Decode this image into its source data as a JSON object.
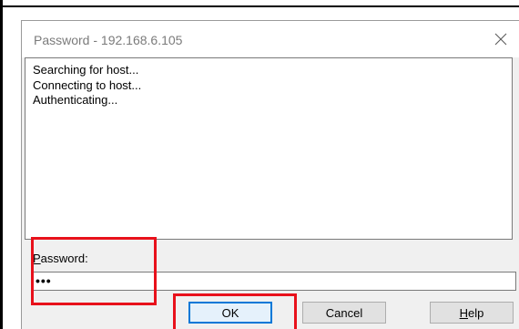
{
  "dialog": {
    "title": "Password - 192.168.6.105",
    "close_icon": "close-icon",
    "log_lines": [
      "Searching for host...",
      "Connecting to host...",
      "Authenticating..."
    ],
    "password_label_underlined": "P",
    "password_label_rest": "assword:",
    "password_value": "•••",
    "buttons": {
      "ok": "OK",
      "cancel": "Cancel",
      "help_underlined": "H",
      "help_rest": "elp"
    }
  },
  "annotations": {
    "highlight_color": "#e8111b"
  }
}
